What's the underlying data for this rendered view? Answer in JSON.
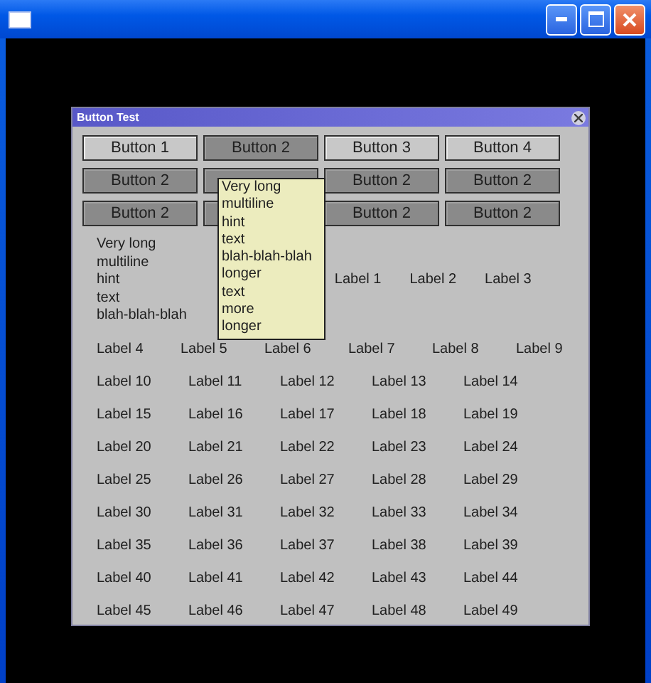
{
  "dialog": {
    "title": "Button Test"
  },
  "button_rows": [
    [
      {
        "label": "Button 1",
        "pressed": false
      },
      {
        "label": "Button 2",
        "pressed": true
      },
      {
        "label": "Button 3",
        "pressed": false
      },
      {
        "label": "Button 4",
        "pressed": false
      }
    ],
    [
      {
        "label": "Button 2",
        "pressed": true
      },
      {
        "pressed": true
      },
      {
        "label": "Button 2",
        "pressed": true
      },
      {
        "label": "Button 2",
        "pressed": true
      }
    ],
    [
      {
        "label": "Button 2",
        "pressed": true
      },
      {
        "pressed": true
      },
      {
        "label": "Button 2",
        "pressed": true
      },
      {
        "label": "Button 2",
        "pressed": true
      }
    ]
  ],
  "hint_label": "Very long\nmultiline\nhint\ntext\nblah-blah-blah",
  "first_row_labels": [
    "Label 1",
    "Label 2",
    "Label 3"
  ],
  "label_rows": [
    [
      "Label 4",
      "Label 5",
      "Label 6",
      "Label 7",
      "Label 8",
      "Label 9"
    ],
    [
      "Label 10",
      "Label 11",
      "Label 12",
      "Label 13",
      "Label 14"
    ],
    [
      "Label 15",
      "Label 16",
      "Label 17",
      "Label 18",
      "Label 19"
    ],
    [
      "Label 20",
      "Label 21",
      "Label 22",
      "Label 23",
      "Label 24"
    ],
    [
      "Label 25",
      "Label 26",
      "Label 27",
      "Label 28",
      "Label 29"
    ],
    [
      "Label 30",
      "Label 31",
      "Label 32",
      "Label 33",
      "Label 34"
    ],
    [
      "Label 35",
      "Label 36",
      "Label 37",
      "Label 38",
      "Label 39"
    ],
    [
      "Label 40",
      "Label 41",
      "Label 42",
      "Label 43",
      "Label 44"
    ],
    [
      "Label 45",
      "Label 46",
      "Label 47",
      "Label 48",
      "Label 49"
    ]
  ],
  "tooltip": "Very long\nmultiline\nhint\ntext\nblah-blah-blah\nlonger\ntext\nmore\nlonger"
}
